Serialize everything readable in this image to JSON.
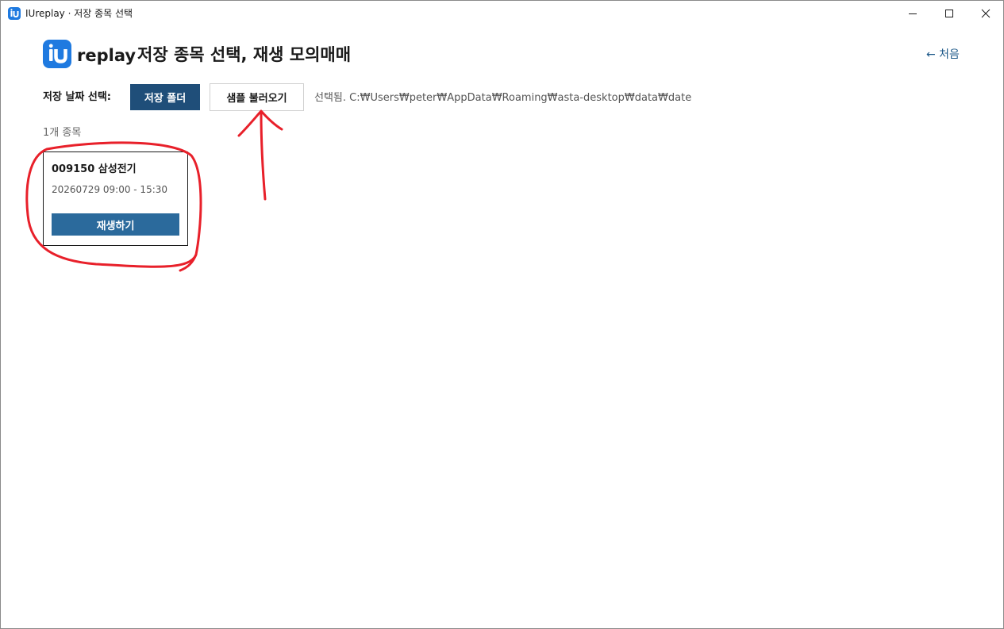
{
  "window": {
    "title": "IUreplay · 저장 종목 선택",
    "controls": {
      "minimize": "minimize-icon",
      "maximize": "maximize-icon",
      "close": "close-icon"
    }
  },
  "header": {
    "logo_letters": "iU",
    "brand": "replay",
    "title": "저장 종목 선택, 재생 모의매매",
    "home_link": "← 처음"
  },
  "toolbar": {
    "date_label": "저장 날짜 선택:",
    "folder_button": "저장 폴더",
    "sample_button": "샘플 불러오기",
    "selected_path": "선택됨. C:₩Users₩peter₩AppData₩Roaming₩asta-desktop₩data₩date"
  },
  "list": {
    "count_label": "1개 종목",
    "items": [
      {
        "name": "009150 삼성전기",
        "time_range": "20260729 09:00 - 15:30",
        "play_button": "재생하기"
      }
    ]
  },
  "colors": {
    "brand": "#1f7ae0",
    "folder_button": "#1f4e79",
    "play_button": "#2b6a9c",
    "annotation": "#e8202a"
  }
}
